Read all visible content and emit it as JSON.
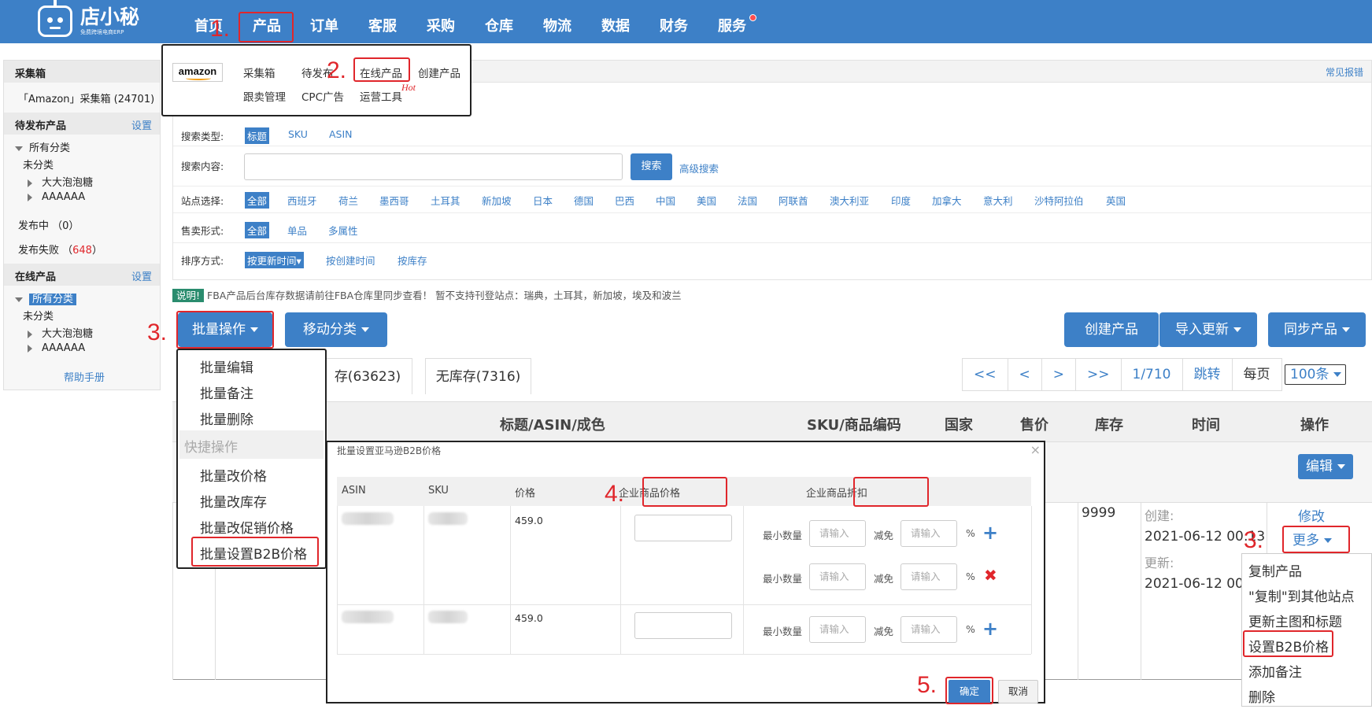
{
  "nav": {
    "logo_name": "店小秘",
    "logo_sub": "免费跨境电商ERP",
    "items": [
      "首页",
      "产品",
      "订单",
      "客服",
      "采购",
      "仓库",
      "物流",
      "数据",
      "财务",
      "服务"
    ]
  },
  "steps": [
    "1.",
    "2.",
    "3.",
    "3.",
    "4.",
    "5."
  ],
  "product_menu": {
    "logo": "amazon",
    "row1": [
      "采集箱",
      "待发布",
      "在线产品",
      "创建产品"
    ],
    "row2": [
      "跟卖管理",
      "CPC广告",
      "运营工具"
    ],
    "hot": "Hot"
  },
  "sidebar": {
    "collect_head": "采集箱",
    "collect_item": "「Amazon」采集箱 (24701)",
    "pending_head": "待发布产品",
    "pending_link": "设置",
    "all_cat": "所有分类",
    "uncat": "未分类",
    "cat1": "大大泡泡糖",
    "cat2": "AAAAAA",
    "publishing": "发布中 （0）",
    "failed_label": "发布失败 （",
    "failed_count": "648",
    "failed_close": "）",
    "online_head": "在线产品",
    "online_link": "设置",
    "online_all": "所有分类",
    "online_uncat": "未分类",
    "online_cat1": "大大泡泡糖",
    "online_cat2": "AAAAAA",
    "help": "帮助手册"
  },
  "main": {
    "faq": "常见报错",
    "search_type_label": "搜索类型:",
    "search_types": [
      "标题",
      "SKU",
      "ASIN"
    ],
    "search_content_label": "搜索内容:",
    "search_btn": "搜索",
    "adv_search": "高级搜索",
    "site_label": "站点选择:",
    "sites": [
      "全部",
      "西班牙",
      "荷兰",
      "墨西哥",
      "土耳其",
      "新加坡",
      "日本",
      "德国",
      "巴西",
      "中国",
      "美国",
      "法国",
      "阿联酋",
      "澳大利亚",
      "印度",
      "加拿大",
      "意大利",
      "沙特阿拉伯",
      "英国"
    ],
    "sale_label": "售卖形式:",
    "sale_types": [
      "全部",
      "单品",
      "多属性"
    ],
    "sort_label": "排序方式:",
    "sorts": [
      "按更新时间▾",
      "按创建时间",
      "按库存"
    ]
  },
  "notice": {
    "tag": "说明!",
    "text": "FBA产品后台库存数据请前往FBA仓库里同步查看！ 暂不支持刊登站点：瑞典，土耳其，新加坡，埃及和波兰"
  },
  "toolbar": {
    "batch": "批量操作",
    "move": "移动分类",
    "create": "创建产品",
    "import": "导入更新",
    "sync": "同步产品"
  },
  "tabs": [
    "存(63623)",
    "无库存(7316)"
  ],
  "pager": [
    "<<",
    "<",
    ">",
    ">>",
    "1/710",
    "跳转"
  ],
  "pager_label": "每页",
  "per_page": "100条",
  "table": {
    "headers": [
      "标题/ASIN/成色",
      "SKU/商品编码",
      "国家",
      "售价",
      "库存",
      "时间",
      "操作"
    ],
    "edit_btn": "编辑",
    "stock": "9999",
    "created_label": "创建:",
    "created_time": "2021-06-12 00:13",
    "updated_label": "更新:",
    "updated_time": "2021-06-12 00",
    "modify": "修改",
    "more": "更多"
  },
  "batch_menu": {
    "items": [
      "批量编辑",
      "批量备注",
      "批量删除"
    ],
    "section": "快捷操作",
    "quick": [
      "批量改价格",
      "批量改库存",
      "批量改促销价格",
      "批量设置B2B价格"
    ]
  },
  "modal": {
    "title": "批量设置亚马逊B2B价格",
    "headers": [
      "ASIN",
      "SKU",
      "价格",
      "企业商品价格",
      "企业商品折扣"
    ],
    "row1_price": "459.0",
    "row2_price": "459.0",
    "min_qty": "最小数量",
    "discount": "减免",
    "placeholder": "请输入",
    "percent": "%",
    "ok": "确定",
    "cancel": "取消"
  },
  "more_menu": [
    "复制产品",
    "\"复制\"到其他站点",
    "更新主图和标题",
    "设置B2B价格",
    "添加备注",
    "删除"
  ]
}
